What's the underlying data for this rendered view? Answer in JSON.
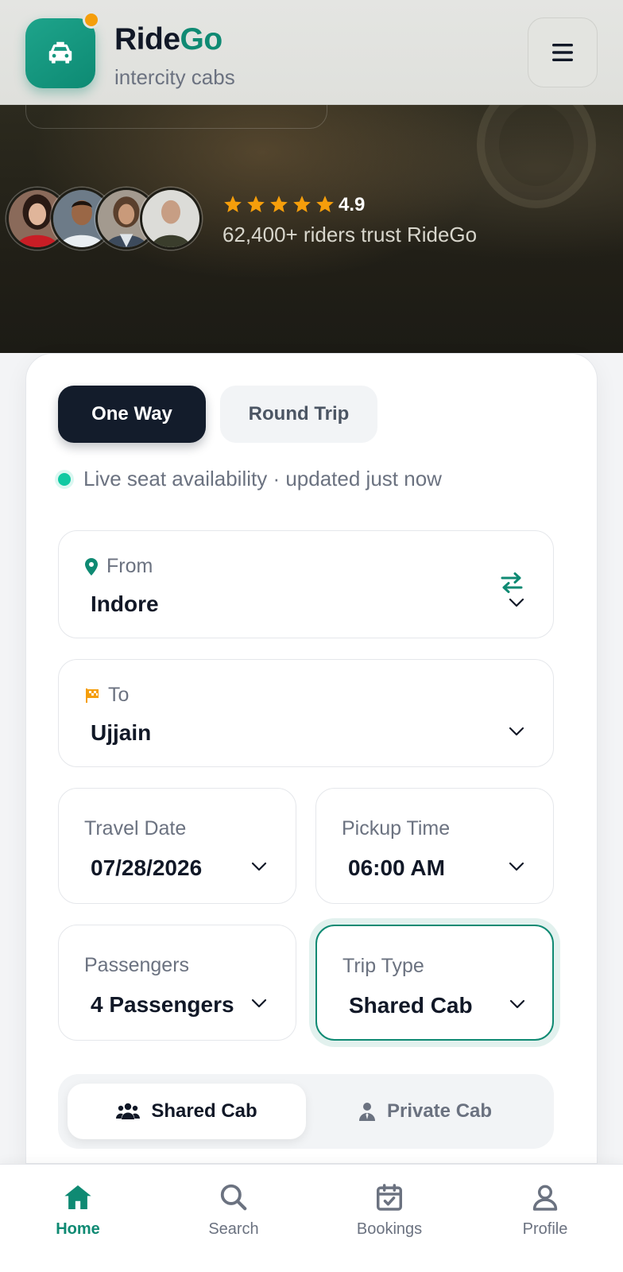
{
  "header": {
    "brand_part1": "Ride",
    "brand_part2": "Go",
    "tagline": "intercity cabs",
    "logo_icon": "car-icon",
    "menu_icon": "hamburger-menu-icon"
  },
  "hero": {
    "rating": "4.9",
    "rating_stars": 5,
    "trust_text": "62,400+ riders trust RideGo",
    "avatars": [
      "rider-avatar-1",
      "rider-avatar-2",
      "rider-avatar-3",
      "rider-avatar-4"
    ]
  },
  "tabs": {
    "one_way": "One Way",
    "round_trip": "Round Trip",
    "active": "one_way"
  },
  "live_status": "Live seat availability · updated just now",
  "form": {
    "from": {
      "label": "From",
      "value": "Indore",
      "icon": "map-pin-icon"
    },
    "to": {
      "label": "To",
      "value": "Ujjain",
      "icon": "checkered-flag-icon"
    },
    "travel_date": {
      "label": "Travel Date",
      "value": "07/28/2026"
    },
    "pickup_time": {
      "label": "Pickup Time",
      "value": "06:00 AM"
    },
    "passengers": {
      "label": "Passengers",
      "value": "4 Passengers"
    },
    "trip_type": {
      "label": "Trip Type",
      "value": "Shared Cab"
    }
  },
  "cab_toggle": {
    "shared": "Shared Cab",
    "private": "Private Cab",
    "active": "shared"
  },
  "bottom_nav": [
    {
      "label": "Home",
      "icon": "home-icon",
      "active": true
    },
    {
      "label": "Search",
      "icon": "search-icon",
      "active": false
    },
    {
      "label": "Bookings",
      "icon": "calendar-check-icon",
      "active": false
    },
    {
      "label": "Profile",
      "icon": "user-icon",
      "active": false
    }
  ],
  "colors": {
    "brand": "#0f8a73",
    "accent_dot": "#f59e0b",
    "dark": "#131c2b",
    "live": "#10c9a2",
    "star": "#f59e0b"
  }
}
